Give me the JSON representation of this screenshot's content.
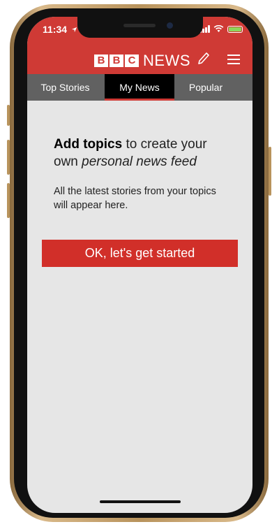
{
  "status": {
    "time": "11:34"
  },
  "brand": {
    "bbc_letters": [
      "B",
      "B",
      "C"
    ],
    "news_word": "NEWS"
  },
  "tabs": [
    {
      "label": "Top Stories",
      "active": false
    },
    {
      "label": "My News",
      "active": true
    },
    {
      "label": "Popular",
      "active": false
    }
  ],
  "content": {
    "headline_bold": "Add topics",
    "headline_rest": " to create your own ",
    "headline_italic": "personal news feed",
    "subtext": "All the latest stories from your topics will appear here.",
    "cta_label": "OK, let's get started"
  },
  "colors": {
    "brand_red": "#cf3a35",
    "tab_bar": "#616161",
    "active_tab": "#000000",
    "background": "#e6e6e6",
    "button": "#d12f29"
  },
  "icons": [
    "location-arrow-icon",
    "signal-icon",
    "wifi-icon",
    "battery-icon",
    "pencil-icon",
    "hamburger-menu-icon"
  ]
}
